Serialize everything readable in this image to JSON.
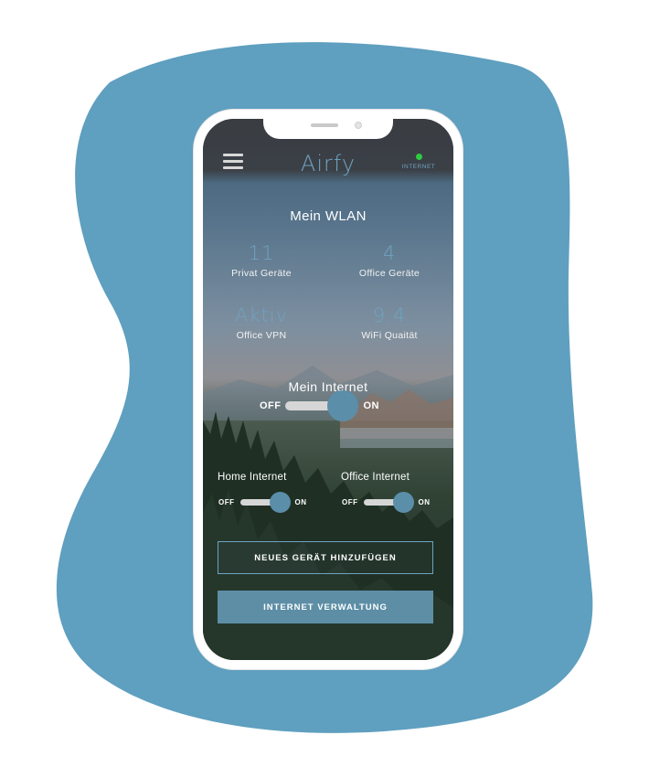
{
  "app": {
    "logo": "Airfy",
    "status_label": "INTERNET",
    "status_color": "#2ecc40",
    "accent_color": "#6fa3c0",
    "blob_color": "#5f9fbf"
  },
  "wlan": {
    "title": "Mein WLAN",
    "stats": [
      {
        "value": "11",
        "label": "Privat Geräte"
      },
      {
        "value": "4",
        "label": "Office Geräte"
      },
      {
        "value": "Aktiv",
        "label": "Office VPN"
      },
      {
        "value": "9.4",
        "label": "WiFi Quaität"
      }
    ]
  },
  "internet": {
    "title": "Mein Internet",
    "off_label": "OFF",
    "on_label": "ON",
    "state": "on"
  },
  "home_internet": {
    "title": "Home Internet",
    "off_label": "OFF",
    "on_label": "ON",
    "state": "on"
  },
  "office_internet": {
    "title": "Office Internet",
    "off_label": "OFF",
    "on_label": "ON",
    "state": "on"
  },
  "buttons": {
    "add_device": "NEUES GERÄT HINZUFÜGEN",
    "internet_management": "INTERNET VERWALTUNG"
  }
}
